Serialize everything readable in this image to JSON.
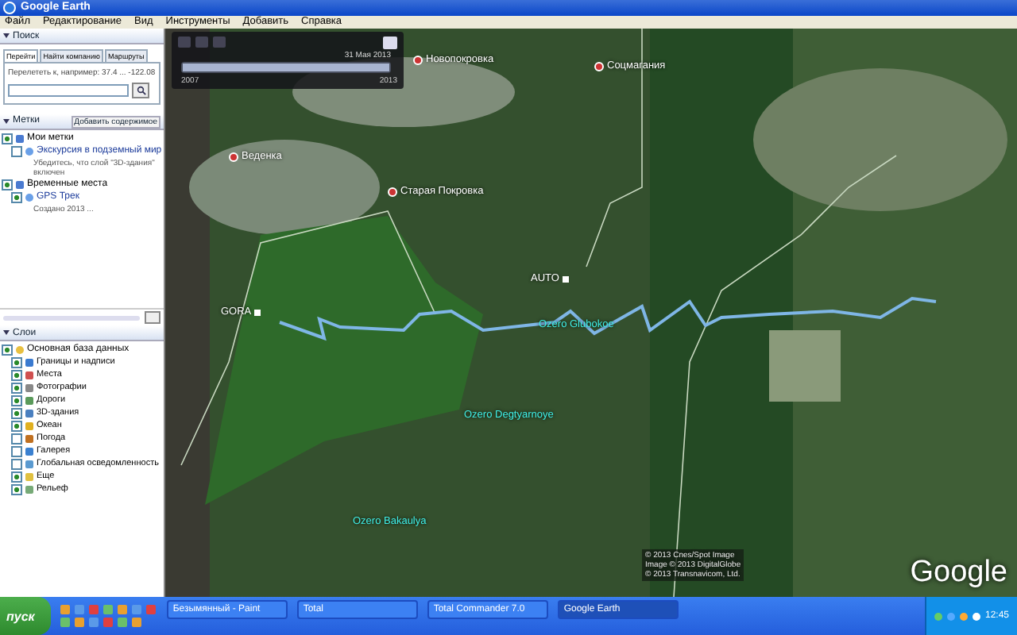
{
  "window": {
    "title": "Google Earth"
  },
  "menu": [
    "Файл",
    "Редактирование",
    "Вид",
    "Инструменты",
    "Добавить",
    "Справка"
  ],
  "search": {
    "heading": "Поиск",
    "expanded": true,
    "tabs": [
      {
        "label": "Перейти",
        "selected": true
      },
      {
        "label": "Найти компанию",
        "selected": false
      },
      {
        "label": "Маршруты",
        "selected": false
      }
    ],
    "hint": "Перелететь к, например: 37.4 ... -122.08"
  },
  "places": {
    "heading": "Метки",
    "expanded": true,
    "add_button": "Добавить содержимое",
    "items": [
      {
        "label": "Мои метки",
        "checked": true,
        "children": [
          {
            "label": "Экскурсия в подземный мир",
            "description": "Убедитесь, что слой \"3D-здания\" включен",
            "checked": false
          }
        ]
      },
      {
        "label": "Временные места",
        "checked": true,
        "children": [
          {
            "label": "GPS Трек",
            "description": "Создано 2013 ...",
            "checked": true
          }
        ]
      }
    ]
  },
  "layers": {
    "heading": "Слои",
    "expanded": true,
    "items": [
      {
        "label": "Основная база данных",
        "checked": true,
        "children": [
          {
            "label": "Границы и надписи",
            "checked": true
          },
          {
            "label": "Места",
            "checked": true
          },
          {
            "label": "Фотографии",
            "checked": true
          },
          {
            "label": "Дороги",
            "checked": true
          },
          {
            "label": "3D-здания",
            "checked": true
          },
          {
            "label": "Океан",
            "checked": true
          },
          {
            "label": "Погода",
            "checked": false
          },
          {
            "label": "Галерея",
            "checked": false
          },
          {
            "label": "Глобальная осведомленность",
            "checked": false
          },
          {
            "label": "Еще",
            "checked": true
          },
          {
            "label": "Рельеф",
            "checked": true
          }
        ]
      }
    ]
  },
  "time_slider": {
    "start": "2007",
    "date": "31 Мая 2013",
    "end": "2013",
    "level": 1
  },
  "map": {
    "labels": [
      {
        "text": "Новопокровка",
        "kind": "town"
      },
      {
        "text": "Соцмагания",
        "kind": "town"
      },
      {
        "text": "Веденка",
        "kind": "town"
      },
      {
        "text": "Старая Покровка",
        "kind": "town"
      },
      {
        "text": "GORA",
        "kind": "point"
      },
      {
        "text": "AUTO",
        "kind": "point"
      },
      {
        "text": "Ozero Glubokoe",
        "kind": "water"
      },
      {
        "text": "Ozero Degtyarnoye",
        "kind": "water"
      },
      {
        "text": "Ozero Bakaulya",
        "kind": "water"
      }
    ],
    "attribution": [
      "© 2013 Cnes/Spot Image",
      "Image © 2013 DigitalGlobe",
      "© 2013 Transnavicom, Ltd."
    ],
    "logo": "Google"
  },
  "taskbar": {
    "start": "пуск",
    "tasks": [
      {
        "label": "Безымянный - Paint",
        "selected": false
      },
      {
        "label": "Total",
        "selected": false
      },
      {
        "label": "Total Commander 7.0",
        "selected": false
      },
      {
        "label": "Google Earth",
        "selected": true
      }
    ],
    "clock": "12:45"
  }
}
